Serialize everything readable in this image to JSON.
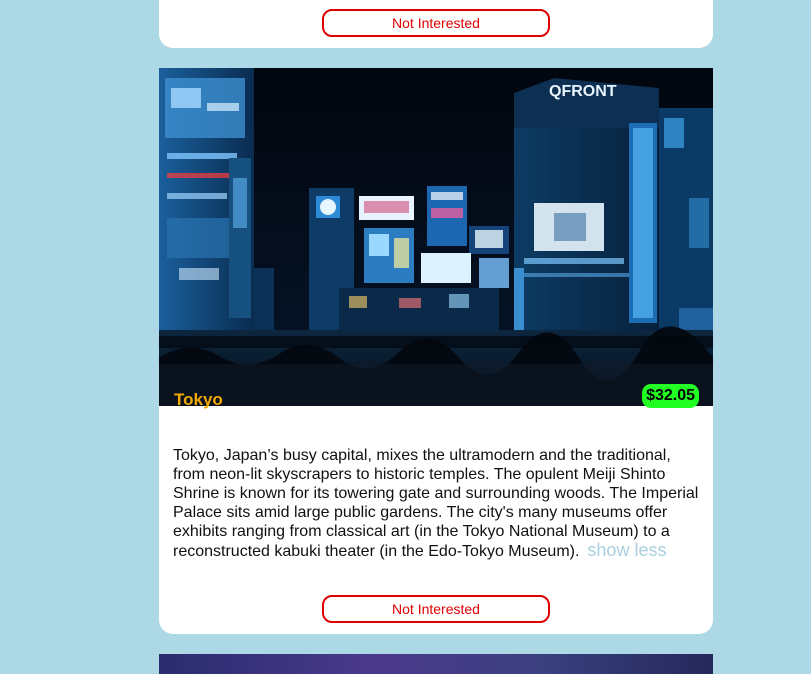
{
  "cards": [
    {
      "not_interested_label": "Not Interested"
    },
    {
      "city": "Tokyo",
      "price": "$32.05",
      "description": "Tokyo, Japan’s busy capital, mixes the ultramodern and the traditional, from neon-lit skyscrapers to historic temples. The opulent Meiji Shinto Shrine is known for its towering gate and surrounding woods. The Imperial Palace sits amid large public gardens. The city's many museums offer exhibits ranging from classical art (in the Tokyo National Museum) to a reconstructed kabuki theater (in the Edo-Tokyo Museum).",
      "show_less_label": "show less",
      "not_interested_label": "Not Interested",
      "image_sign_text": "QFRONT"
    }
  ],
  "colors": {
    "page_background": "#add8e6",
    "card_background": "#ffffff",
    "button_accent": "#e00000",
    "city_name": "#f2a900",
    "price_badge": "#22ff22",
    "show_less": "#a9cfe0"
  }
}
